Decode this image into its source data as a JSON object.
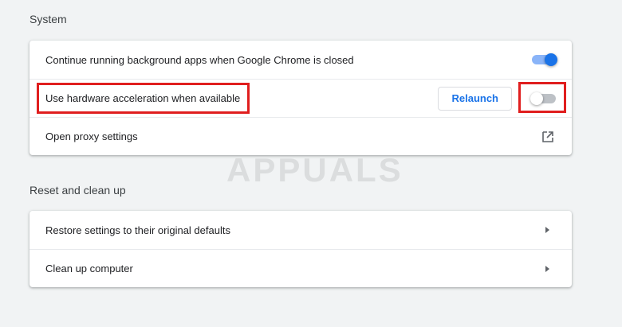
{
  "system": {
    "title": "System",
    "rows": [
      {
        "label": "Continue running background apps when Google Chrome is closed",
        "control": "toggle",
        "checked": true
      },
      {
        "label": "Use hardware acceleration when available",
        "control": "toggle",
        "checked": false,
        "button_label": "Relaunch"
      },
      {
        "label": "Open proxy settings",
        "control": "external-link-icon"
      }
    ]
  },
  "reset": {
    "title": "Reset and clean up",
    "rows": [
      {
        "label": "Restore settings to their original defaults",
        "control": "arrow-right-icon"
      },
      {
        "label": "Clean up computer",
        "control": "arrow-right-icon"
      }
    ]
  },
  "watermark": {
    "text": "APPUALS"
  },
  "colors": {
    "accent": "#1a73e8",
    "highlight": "#e01e1e",
    "background": "#f1f3f4"
  }
}
